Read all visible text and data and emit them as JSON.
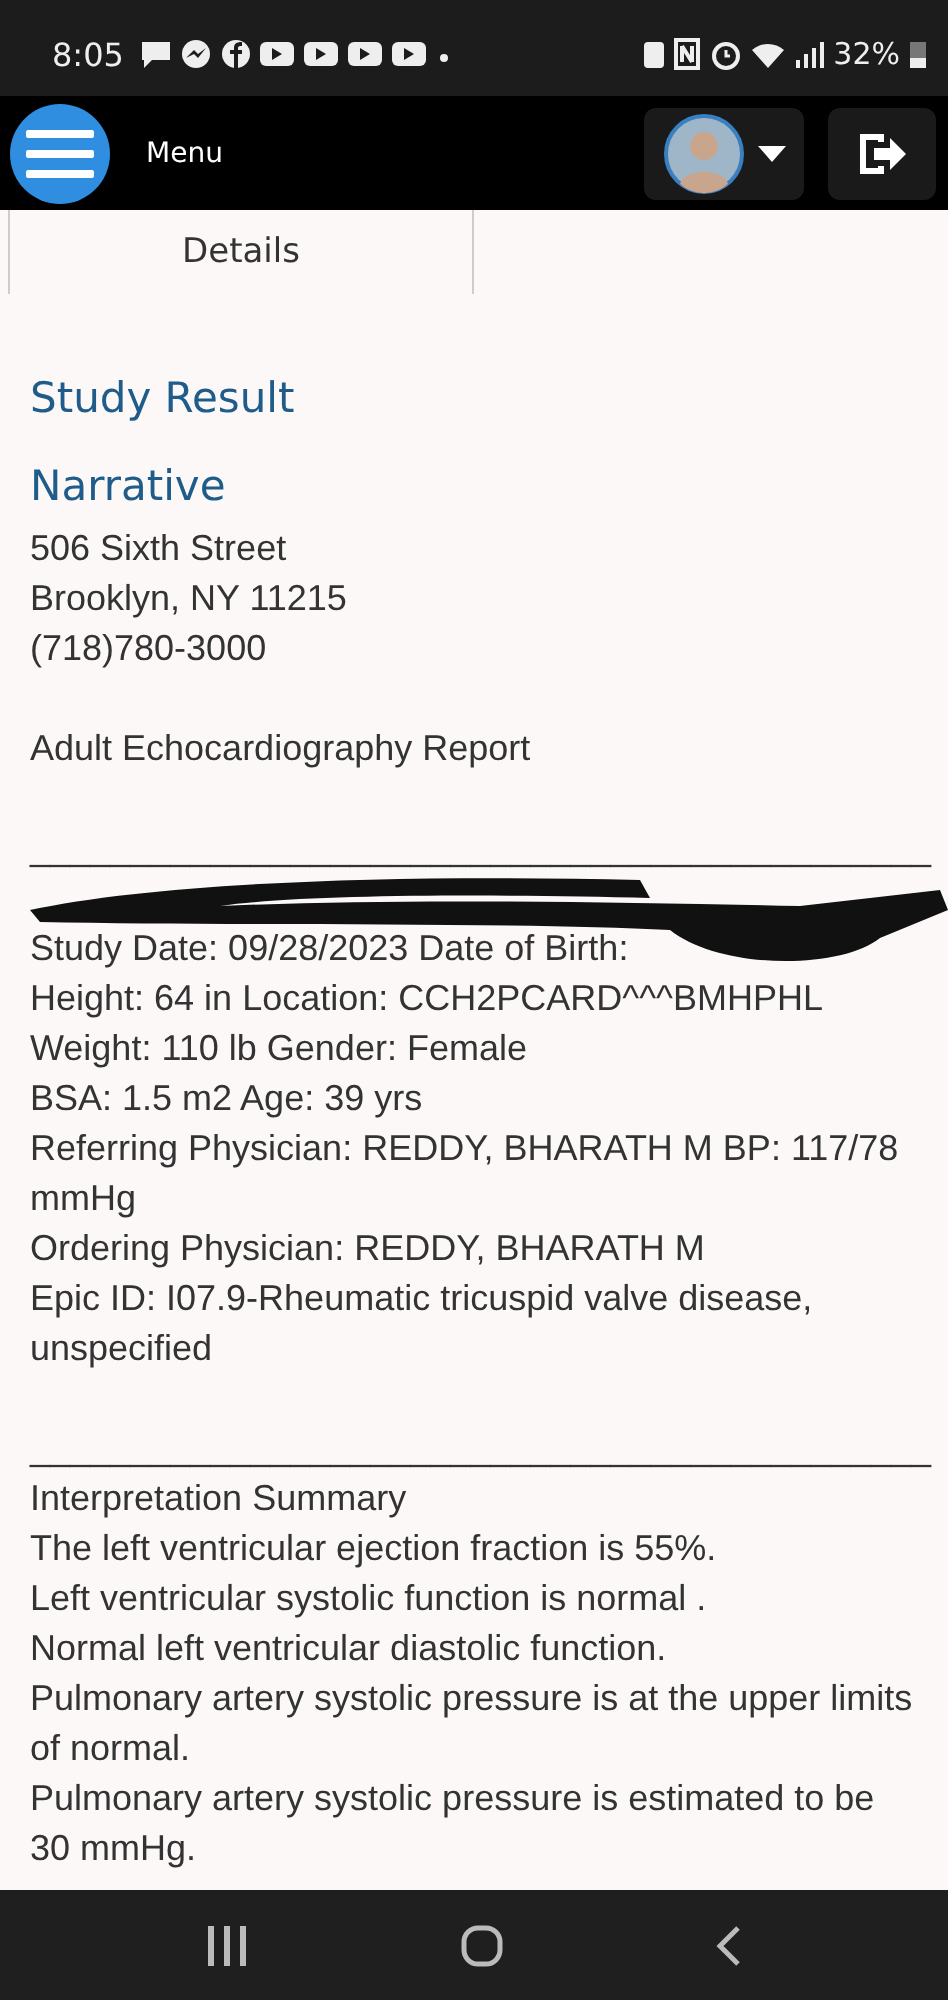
{
  "status_bar": {
    "time": "8:05",
    "battery": "32%"
  },
  "app_bar": {
    "menu_label": "Menu"
  },
  "tabs": [
    {
      "label": "Details",
      "selected": true
    }
  ],
  "report": {
    "title": "Study Result",
    "section": "Narrative",
    "address": [
      "506 Sixth Street",
      "Brooklyn, NY 11215",
      "(718)780-3000"
    ],
    "report_name": "Adult Echocardiography Report",
    "rule": "_____________________________________________",
    "study_line": "Study Date: 09/28/2023 Date of Birth:",
    "details": [
      "Height: 64 in Location: CCH2PCARD^^^BMHPHL",
      "Weight: 110 lb Gender: Female",
      "BSA: 1.5 m2 Age: 39 yrs",
      "Referring Physician: REDDY, BHARATH M BP: 117/78 mmHg",
      "Ordering Physician: REDDY, BHARATH M",
      "Epic ID: I07.9-Rheumatic tricuspid valve disease, unspecified"
    ],
    "rule2": "_____________________________________________",
    "summary_title": "Interpretation Summary",
    "summary": [
      "The left ventricular ejection fraction is 55%.",
      "Left ventricular systolic function is normal .",
      "Normal left ventricular diastolic function.",
      "Pulmonary artery systolic pressure is at the upper limits of normal.",
      "Pulmonary artery systolic pressure is estimated to be 30 mmHg."
    ]
  }
}
